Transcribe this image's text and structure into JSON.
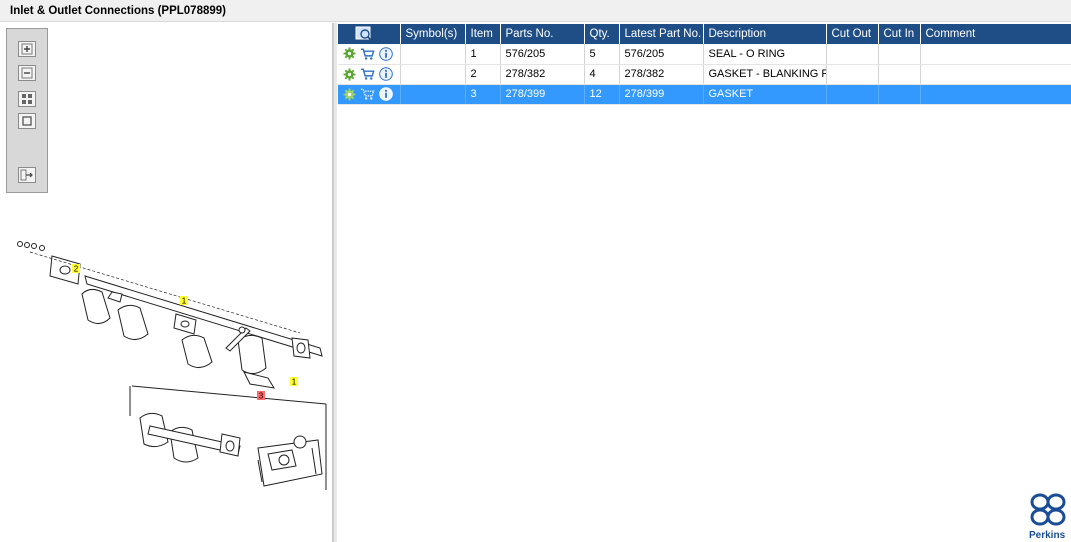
{
  "window": {
    "title": "Inlet & Outlet Connections (PPL078899)"
  },
  "viewer_toolbar": {
    "buttons": [
      "zoom-in-icon",
      "zoom-out-icon",
      "fit-all-icon",
      "actual-size-icon",
      "export-icon"
    ]
  },
  "diagram": {
    "callouts": [
      {
        "label": "2",
        "color": "#ffff33"
      },
      {
        "label": "1",
        "color": "#ffff33"
      },
      {
        "label": "3",
        "color": "#ff6a6a"
      },
      {
        "label": "1",
        "color": "#ffff33"
      }
    ]
  },
  "table": {
    "columns": {
      "symbols": "Symbol(s)",
      "item": "Item",
      "parts_no": "Parts No.",
      "qty": "Qty.",
      "latest_part_no": "Latest Part No.",
      "description": "Description",
      "cut_out": "Cut Out",
      "cut_in": "Cut In",
      "comment": "Comment"
    },
    "rows": [
      {
        "symbols": "",
        "item": "1",
        "parts_no": "576/205",
        "qty": "5",
        "latest_part_no": "576/205",
        "description": "SEAL - O RING",
        "cut_out": "",
        "cut_in": "",
        "comment": "",
        "selected": false
      },
      {
        "symbols": "",
        "item": "2",
        "parts_no": "278/382",
        "qty": "4",
        "latest_part_no": "278/382",
        "description": "GASKET - BLANKING PLA",
        "cut_out": "",
        "cut_in": "",
        "comment": "",
        "selected": false
      },
      {
        "symbols": "",
        "item": "3",
        "parts_no": "278/399",
        "qty": "12",
        "latest_part_no": "278/399",
        "description": "GASKET",
        "cut_out": "",
        "cut_in": "",
        "comment": "",
        "selected": true
      }
    ],
    "row_icons": [
      "gear-icon",
      "cart-icon",
      "info-icon"
    ],
    "header_icon": "view-part-icon"
  },
  "branding": {
    "logo": "perkins-logo",
    "logo_text": "Perkins",
    "color": "#1a4d96"
  },
  "colors": {
    "header_bg": "#1f4e86",
    "selected_row": "#3399ff",
    "gear": "#5aa832",
    "cart": "#2f6fc4",
    "info": "#2e6fd0"
  }
}
